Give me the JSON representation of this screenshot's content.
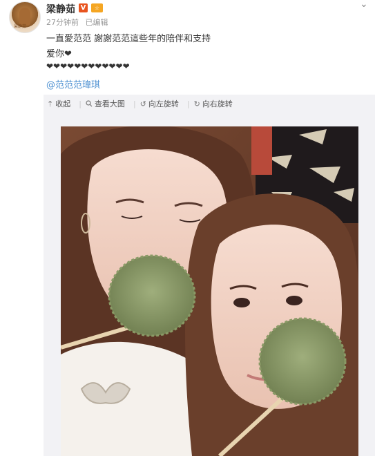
{
  "post": {
    "author": "梁静茹",
    "verified_badge": "V",
    "member_badge": "☆",
    "time": "27分钟前",
    "edited": "已编辑",
    "text_line1": "一直愛范范 謝謝范范這些年的陪伴和支持",
    "text_line2": "爱你❤",
    "text_line3": "❤❤❤❤❤❤❤❤❤❤❤❤",
    "mention": "@范范范瑋琪"
  },
  "avatar": {
    "caption": "梁静茹"
  },
  "toolbar": {
    "collapse": "收起",
    "view_large": "查看大图",
    "rotate_left": "向左旋转",
    "rotate_right": "向右旋转"
  },
  "icons": {
    "collapse": "collapse-up-icon",
    "view_large": "magnifier-icon",
    "rotate_left": "rotate-left-icon",
    "rotate_right": "rotate-right-icon",
    "dropdown": "chevron-down-icon"
  },
  "colors": {
    "link": "#4b8fd1",
    "badge_v": "#e8541f",
    "badge_member": "#f5a623"
  }
}
